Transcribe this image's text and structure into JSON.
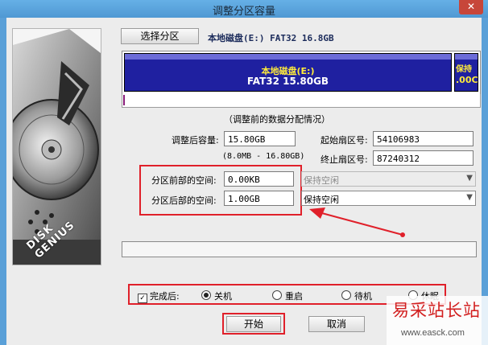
{
  "window": {
    "title": "调整分区容量",
    "close_glyph": "✕"
  },
  "toolbar": {
    "select_partition_label": "选择分区",
    "disk_label": "本地磁盘(E:) FAT32 16.8GB"
  },
  "disk_map": {
    "partition_name": "本地磁盘(E:)",
    "partition_desc": "FAT32 15.80GB",
    "free_label_1": "保持",
    "free_label_2": ".00C"
  },
  "section_title": "（调整前的数据分配情况）",
  "fields": {
    "adjusted_size_label": "调整后容量:",
    "adjusted_size_value": "15.80GB",
    "range_text": "(8.0MB - 16.80GB)",
    "start_sector_label": "起始扇区号:",
    "start_sector_value": "54106983",
    "end_sector_label": "终止扇区号:",
    "end_sector_value": "87240312",
    "before_space_label": "分区前部的空间:",
    "before_space_value": "0.00KB",
    "before_action": "保持空闲",
    "after_space_label": "分区后部的空间:",
    "after_space_value": "1.00GB",
    "after_action": "保持空闲"
  },
  "completion": {
    "label": "完成后:",
    "checked": true,
    "options": [
      "关机",
      "重启",
      "待机",
      "休眠"
    ],
    "selected": "关机"
  },
  "buttons": {
    "start": "开始",
    "cancel": "取消"
  },
  "brand": "DISK GENIUS",
  "watermark": {
    "line1": "易采站长站",
    "line2": "www.easck.com"
  },
  "colors": {
    "partition_blue": "#1f20a0",
    "highlight_red": "#e0202a",
    "title_bar": "#5aa0d8"
  }
}
